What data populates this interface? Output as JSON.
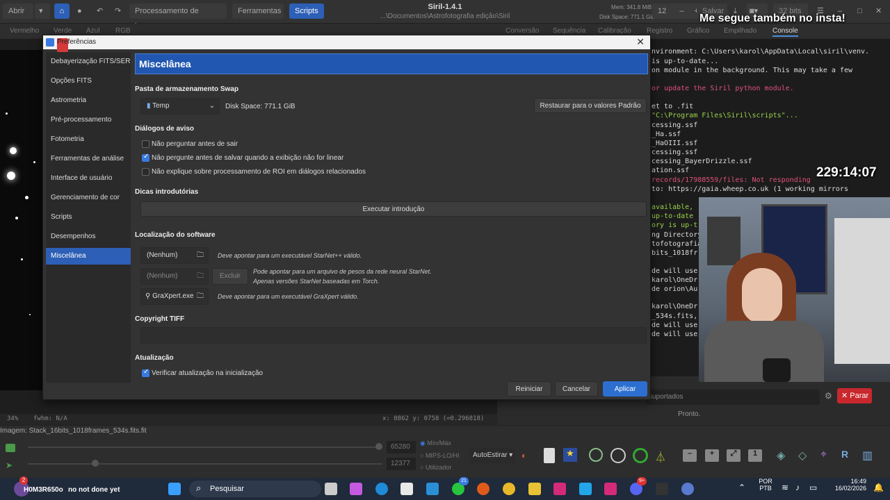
{
  "header": {
    "open_label": "Abrir",
    "menus": [
      "Processamento de imagem",
      "Ferramentas",
      "Scripts"
    ],
    "title": "Siril-1.4.1",
    "path": "...\\Documentos\\Astrofotografia edição\\Siril",
    "mem": "Mem: 341.8 MiB",
    "disk": "Disk Space: 771.1 GiB",
    "thread_count": "12",
    "save_label": "Salvar",
    "bits_label": "32 bits"
  },
  "channel_tabs": [
    "Vermelho",
    "Verde",
    "Azul",
    "RGB"
  ],
  "right_tabs": [
    "Conversão",
    "Sequência",
    "Calibração",
    "Registro",
    "Gráfico",
    "Empilhado",
    "Console"
  ],
  "overlay": {
    "insta": "Me segue também no insta!",
    "timer": "229:14:07"
  },
  "console_lines": [
    {
      "text": "nvironment: C:\\Users\\karol\\AppData\\Local\\siril\\venv.",
      "color": "#ddd"
    },
    {
      "text": " is up-to-date...",
      "color": "#ddd"
    },
    {
      "text": "on module in the background. This may take a few",
      "color": "#ddd"
    },
    {
      "text": "or update the Siril python module.",
      "color": "#e0527a"
    },
    {
      "text": "et to .fit",
      "color": "#ddd"
    },
    {
      "text": "\"C:\\Program Files\\Siril\\scripts\"...",
      "color": "#9bd34a"
    },
    {
      "text": "cessing.ssf",
      "color": "#ddd"
    },
    {
      "text": "_Ha.ssf",
      "color": "#ddd"
    },
    {
      "text": "_HaOIII.ssf",
      "color": "#ddd"
    },
    {
      "text": "cessing.ssf",
      "color": "#ddd"
    },
    {
      "text": "cessing_BayerDrizzle.ssf",
      "color": "#ddd"
    },
    {
      "text": "ation.ssf",
      "color": "#ddd"
    },
    {
      "text": "records/17988559/files: Not responding",
      "color": "#e0527a"
    },
    {
      "text": " to: https://gaia.wheep.co.uk (1 working mirrors",
      "color": "#ddd"
    },
    {
      "text": " available,",
      "color": "#9bd34a"
    },
    {
      "text": " up-to-date",
      "color": "#9bd34a"
    },
    {
      "text": "ory is up-t",
      "color": "#9bd34a"
    },
    {
      "text": "ng Directory",
      "color": "#ddd"
    },
    {
      "text": "tofotografia",
      "color": "#ddd"
    },
    {
      "text": "bits_1018fr",
      "color": "#ddd"
    },
    {
      "text": "de will use",
      "color": "#ddd"
    },
    {
      "text": "karol\\OneDr",
      "color": "#ddd"
    },
    {
      "text": "de orion\\Au",
      "color": "#ddd"
    },
    {
      "text": "karol\\OneDr",
      "color": "#ddd"
    },
    {
      "text": "_534s.fits,",
      "color": "#ddd"
    },
    {
      "text": "de will use",
      "color": "#ddd"
    },
    {
      "text": "de will use",
      "color": "#ddd"
    }
  ],
  "console_footer": {
    "filter_placeholder": "suportados",
    "stop_label": "Parar",
    "status": "Pronto."
  },
  "image_info": {
    "zoom": "34%",
    "fwhm": "fwhm: N/A",
    "coords": "x: 0862  y: 0758 (=0.296818)",
    "filename": "Imagem: Stack_16bits_1018frames_534s.fits.fit",
    "high_value": "65280",
    "low_value": "12377",
    "scale_modes": [
      "Mín/Máx",
      "MIPS-LO/HI",
      "Utilizador"
    ],
    "stretch": "AutoEstirar"
  },
  "dialog": {
    "title": "Preferências",
    "heading": "Miscelânea",
    "sidebar": [
      "Debayerização FITS/SER",
      "Opções FITS",
      "Astrometria",
      "Pré-processamento",
      "Fotometria",
      "Ferramentas de análise",
      "Interface de usuário",
      "Gerenciamento de cor",
      "Scripts",
      "Desempenhos",
      "Miscelânea"
    ],
    "swap": {
      "title": "Pasta de armazenamento Swap",
      "folder": "Temp",
      "disk_space": "Disk Space: 771.1 GiB",
      "restore_label": "Restaurar para o valores Padrão"
    },
    "warnings": {
      "title": "Diálogos de aviso",
      "items": [
        {
          "label": "Não perguntar antes de sair",
          "checked": false
        },
        {
          "label": "Não pergunte antes de salvar quando a exibição não for linear",
          "checked": true
        },
        {
          "label": "Não explique sobre processamento de ROI em diálogos relacionados",
          "checked": false
        }
      ]
    },
    "intro": {
      "title": "Dicas introdutórias",
      "button": "Executar introdução"
    },
    "software": {
      "title": "Localização do software",
      "starnet_value": "(Nenhum)",
      "starnet_hint": "Deve apontar para um executável StarNet++ válido.",
      "weights_value": "(Nenhum)",
      "exclude_label": "Excluir",
      "weights_hint_1": "Pode apontar para um arquivo de pesos da rede neural StarNet.",
      "weights_hint_2": "Apenas versões StarNet baseadas em Torch.",
      "graxpert_value": "GraXpert.exe",
      "graxpert_hint": "Deve apontar para um executável GraXpert válido."
    },
    "copyright": {
      "title": "Copyright TIFF",
      "value": ""
    },
    "update": {
      "title": "Atualização",
      "check_label": "Verificar atualização na inicialização",
      "checked": true
    },
    "footer": {
      "restart": "Reiniciar",
      "cancel": "Cancelar",
      "apply": "Aplicar"
    }
  },
  "taskbar": {
    "user_name": "H0M3R650o",
    "user_status": "no not done yet",
    "user_badge": "2",
    "search_label": "Pesquisar",
    "whatsapp_badge": "21",
    "discord_badge": "9+",
    "language_1": "POR",
    "language_2": "PTB",
    "time": "16:49",
    "date": "16/02/2026"
  }
}
